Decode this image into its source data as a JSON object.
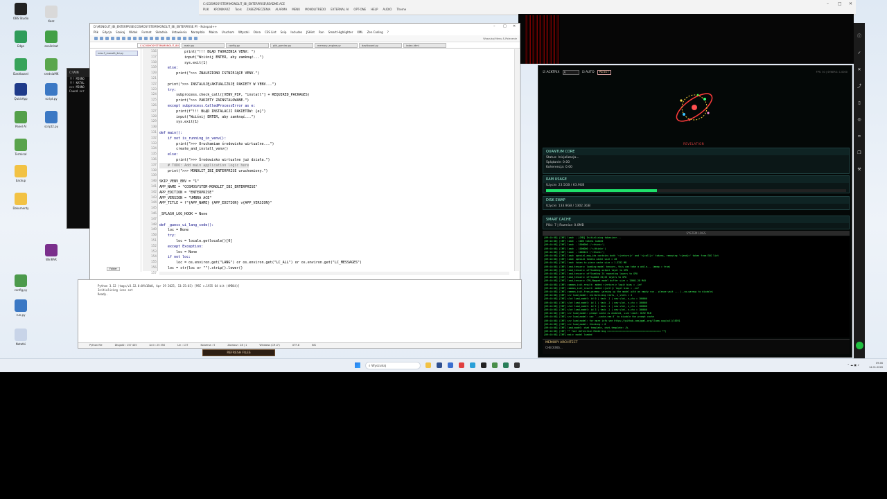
{
  "desktop": {
    "icons": [
      {
        "label": "OBS Studio",
        "color": "#222222"
      },
      {
        "label": "Kosz",
        "color": "#d9d9d9"
      },
      {
        "label": "Edge",
        "color": "#2f9c5a"
      },
      {
        "label": "analiz.bat",
        "color": "#43a047"
      },
      {
        "label": "Dashboard",
        "color": "#37a35a"
      },
      {
        "label": "sredniaMK",
        "color": "#5aa64d"
      },
      {
        "label": "QuickApp",
        "color": "#1f3b8a"
      },
      {
        "label": "script.py",
        "color": "#3b78c4"
      },
      {
        "label": "Panel AI",
        "color": "#53a04a"
      },
      {
        "label": "script2.py",
        "color": "#3b78c4"
      },
      {
        "label": "Terminal",
        "color": "#58a34c"
      },
      {
        "label": "backup",
        "color": "#f2c244"
      },
      {
        "label": "Dokumenty",
        "color": "#f2c244"
      },
      {
        "label": "WinRAR",
        "color": "#7a2f8c"
      },
      {
        "label": "config.py",
        "color": "#4c9a4c"
      },
      {
        "label": "run.py",
        "color": "#3b78c4"
      },
      {
        "label": "Notatki",
        "color": "#c8d4e8"
      }
    ]
  },
  "top_app": {
    "title": "C:\\COSMOSYSTEM\\MONOLIT_IBI_ENTERPRISE\\README.ACE",
    "menu": [
      "PLIK",
      "KRONIKARZ",
      "Tools",
      "ZABEZPIECZENIA",
      "ALARMA",
      "MENU",
      "MONOLITREDO",
      "EXTERNAL AI",
      "OPT-ONE",
      "HELP",
      "AUDIO",
      "Theme"
    ]
  },
  "back_terminal": {
    "title": "C:\\WIN",
    "lines": [
      "",
      "!!! MIONO",
      "!!! KATAL",
      "",
      ">>> MIONO",
      "Found scr"
    ]
  },
  "npp": {
    "title": "D:\\MONOLIT_IBI_ENTERPRISE\\COSMOSYSTEM\\MONOLIT_IBI_ENTERPRISE.PY - Notepad++",
    "menu": [
      "Plik",
      "Edycja",
      "Szukaj",
      "Widok",
      "Format",
      "Składnia",
      "Ustawienia",
      "Narzędzia",
      "Makra",
      "Uruchom",
      "Wtyczki",
      "Okna",
      "CSS Lint",
      "Snip",
      "Includes",
      "JSHint",
      "Run",
      "Smart Highlighter",
      "XML",
      "Zen Coding",
      "?"
    ],
    "search_hint": "Wyszukaj Menu & Polecenie",
    "tabs": [
      "C:\\COSMOSYSTEM\\MONOLIT_IBI",
      "main.py",
      "config.py",
      "plik_pamiec.py",
      "memory_engine.py",
      "dashboard.py",
      "index.html"
    ],
    "sidebar_item": "new-3_monolit_ibi.py",
    "sidebar_tab": "Folder",
    "lines": [
      {
        "n": "116",
        "t": "            print(\"!!! BŁĄD TWORZENIA VENV: \")",
        "c": "#000"
      },
      {
        "n": "117",
        "t": "            input(\"Wciśnij ENTER, aby zamknąć...\")",
        "c": "#000"
      },
      {
        "n": "118",
        "t": "            sys.exit(1)",
        "c": "#000"
      },
      {
        "n": "119",
        "t": "    else:",
        "c": "#000080"
      },
      {
        "n": "120",
        "t": "        print(\">>> ZNALEZIONO ISTNIEJĄCE VENV.\")",
        "c": "#000"
      },
      {
        "n": "121",
        "t": "",
        "c": "#000"
      },
      {
        "n": "122",
        "t": "    print(\">>> INSTALUJĘ/AKTUALIZUJĘ PAKIETY W VENV...\")",
        "c": "#000"
      },
      {
        "n": "123",
        "t": "    try:",
        "c": "#000080"
      },
      {
        "n": "124",
        "t": "        subprocess.check_call([VENV_PIP, \"install\"] + REQUIRED_PACKAGES)",
        "c": "#000"
      },
      {
        "n": "125",
        "t": "        print(\">>> PAKIETY ZAINSTALOWANE.\")",
        "c": "#000"
      },
      {
        "n": "126",
        "t": "    except subprocess.CalledProcessError as e:",
        "c": "#000080"
      },
      {
        "n": "127",
        "t": "        print(f\"!!! BŁĄD INSTALACJI PAKIETÓW: {e}\")",
        "c": "#000"
      },
      {
        "n": "128",
        "t": "        input(\"Wciśnij ENTER, aby zamknąć...\")",
        "c": "#000"
      },
      {
        "n": "129",
        "t": "        sys.exit(1)",
        "c": "#000"
      },
      {
        "n": "130",
        "t": "",
        "c": "#000"
      },
      {
        "n": "131",
        "t": "def main():",
        "c": "#000080"
      },
      {
        "n": "132",
        "t": "    if not is_running_in_venv():",
        "c": "#000080"
      },
      {
        "n": "133",
        "t": "        print(\">>> Uruchamiam środowisko wirtualne...\")",
        "c": "#000"
      },
      {
        "n": "134",
        "t": "        create_and_install_venv()",
        "c": "#000"
      },
      {
        "n": "135",
        "t": "    else:",
        "c": "#000080"
      },
      {
        "n": "136",
        "t": "        print(\">>> Środowisko wirtualne już działa.\")",
        "c": "#000"
      },
      {
        "n": "137",
        "t": "    # TODO: Add main application logic here",
        "c": "#777"
      },
      {
        "n": "138",
        "t": "    print(\">>> MONOLIT_IBI_ENTERPRISE uruchomiony.\")",
        "c": "#000"
      },
      {
        "n": "139",
        "t": "",
        "c": "#000"
      },
      {
        "n": "140",
        "t": "SKIP_VENV_ENV = \"1\"",
        "c": "#000"
      },
      {
        "n": "141",
        "t": "APP_NAME = \"COSMOSYSTEM-MONOLIT_IBI_ENTERPRISE\"",
        "c": "#000"
      },
      {
        "n": "142",
        "t": "APP_EDITION = \"ENTERPRISE\"",
        "c": "#000"
      },
      {
        "n": "143",
        "t": "APP_VERSION = \"UMBRA ACE\"",
        "c": "#000"
      },
      {
        "n": "144",
        "t": "APP_TITLE = f\"{APP_NAME} {APP_EDITION} v{APP_VERSION}\"",
        "c": "#000"
      },
      {
        "n": "145",
        "t": "",
        "c": "#000"
      },
      {
        "n": "146",
        "t": "_SPLASH_LOG_HOOK = None",
        "c": "#000"
      },
      {
        "n": "147",
        "t": "",
        "c": "#000"
      },
      {
        "n": "148",
        "t": "def _guess_ui_lang_code():",
        "c": "#000080"
      },
      {
        "n": "149",
        "t": "    loc = None",
        "c": "#000"
      },
      {
        "n": "150",
        "t": "    try:",
        "c": "#000080"
      },
      {
        "n": "151",
        "t": "        loc = locale.getlocale()[0]",
        "c": "#000"
      },
      {
        "n": "152",
        "t": "    except Exception:",
        "c": "#000080"
      },
      {
        "n": "153",
        "t": "        loc = None",
        "c": "#000"
      },
      {
        "n": "154",
        "t": "    if not loc:",
        "c": "#000080"
      },
      {
        "n": "155",
        "t": "        loc = os.environ.get(\"LANG\") or os.environ.get(\"LC_ALL\") or os.environ.get(\"LC_MESSAGES\")",
        "c": "#000"
      },
      {
        "n": "156",
        "t": "    loc = str(loc or \"\").strip().lower()",
        "c": "#000"
      },
      {
        "n": "157",
        "t": "    if loc.startswith(\"pl\"):",
        "c": "#000080"
      }
    ]
  },
  "pyconsole": {
    "lines": [
      "Python 3.12 (tags/v3.12.0:0fb18b0, Apr 29 2025, 13:25:03) [MSC v.1935 64 bit (AMD64)]",
      "Initializing icon set",
      "Ready."
    ],
    "status": [
      "Python file",
      "Długość : 157 405",
      "Linii : 25 350",
      "Lin : 137",
      "Kolumna : 5",
      "Zaznacz : 28 | 1",
      "Windows (CR LF)",
      "UTF-8",
      "INS"
    ]
  },
  "refresh_label": "REFRESH FILES",
  "dashboard": {
    "checkbox1": "ACKTRIX",
    "input1": "A",
    "checkbox2": "AUTO",
    "reset": "RESET",
    "top_right": "FPS: 30 | SYNERG: 1.0000",
    "revelation": "REVELATION",
    "quantum": {
      "title": "QUANTUM CORE",
      "status": "Status: Inicjalizacja...",
      "splatanie": "Splątanie: 0.00",
      "koherencja": "Koherencja: 0.00"
    },
    "ram": {
      "title": "RAM USAGE",
      "text": "Użycie: 23.5GB / 63.9GB",
      "fill_pct": 37
    },
    "disk": {
      "title": "DISK SWAP",
      "text": "Użycie: 133.9GB / 1302.3GB"
    },
    "cache": {
      "title": "SMART CACHE",
      "text": "Pliki: 7 | Rozmiar: 0.0MB"
    },
    "logs_title": "SYSTEM LOGS",
    "logs": [
      "[09:44:08] [INF] load:  - [CMD] Initializing tokenizer...",
      "[09:44:08] [INF] load:  - 1000 tokens loaded",
      "[09:44:08] [INF] load:  - 1000000 ('<think>')",
      "[09:44:08] [INF] load:  - 1000000 ('</think>')",
      "[09:44:08] [INF] load:  - 1000122 ('<think>')",
      "[09:44:08] [INF] load: special_eog_ids contains both '<|return|>' and '<|call|>' tokens, removing '<|end|>' token from EOG list",
      "[09:44:08] [INF] load: special tokens cache size = 28",
      "[09:44:08] [INF] load: token to piece cache size = 1.3332 MB",
      "[09:44:08] [INF] load_tensors: loading model tensors, this can take a while... (mmap = true)",
      "[09:44:08] [INF] load_tensors: offloading output layer to GPU",
      "[09:44:08] [INF] load_tensors: offloading 24 repeating layers to GPU",
      "[09:44:08] [INF] load_tensors: offloaded 25/25 layers to GPU",
      "[09:44:08] [INF] load_tensors:   CPU_Mapped model buffer size = 13001.28 MiB",
      "[09:44:08] [INF] common_init_result: added <|return|> logit bias = -inf",
      "[09:44:08] [INF] common_init_result: added <|call|> logit bias = -inf",
      "[09:44:08] [INF] common_init_from_params: warming up the model with an empty run - please wait ... (--no-warmup to disable)",
      "[09:44:08] [INF] srv    load_model: initializing slots, n_slots = 4",
      "[09:44:08] [INF] slot   load_model: id  0 | task -1 | new slot, n_ctx = 100000",
      "[09:44:08] [INF] slot   load_model: id  1 | task -1 | new slot, n_ctx = 100000",
      "[09:44:08] [INF] slot   load_model: id  2 | task -1 | new slot, n_ctx = 100000",
      "[09:44:08] [INF] slot   load_model: id  3 | task -1 | new slot, n_ctx = 100000",
      "[09:44:08] [INF] srv    load_model: prompt cache is enabled, size limit: 8192 MiB",
      "[09:44:08] [INF] srv    load_model: use `--cache-ram 0` to disable the prompt cache",
      "[09:44:08] [INF] srv    load_model: for more info see https://github.com/ggml-org/llama.cpp/pull/16391",
      "[09:44:08] [INF] srv    load_model: thinking = 0",
      "[09:44:08] [INF] load_model: chat template, chat_template: {%-",
      "[09:44:08] [INF] ** Tool definition Rendering ======================================= **)",
      "[09:44:08] [INF] main: model loaded",
      "[09:44:08] [INF] srv  update_slots: all slots are idle"
    ],
    "memory": {
      "title": "MEMORY ARCHITECT",
      "text": "CHECKING..."
    }
  },
  "taskbar": {
    "search": "Wyszukaj",
    "time": "09:46",
    "date": "14.01.2026"
  }
}
